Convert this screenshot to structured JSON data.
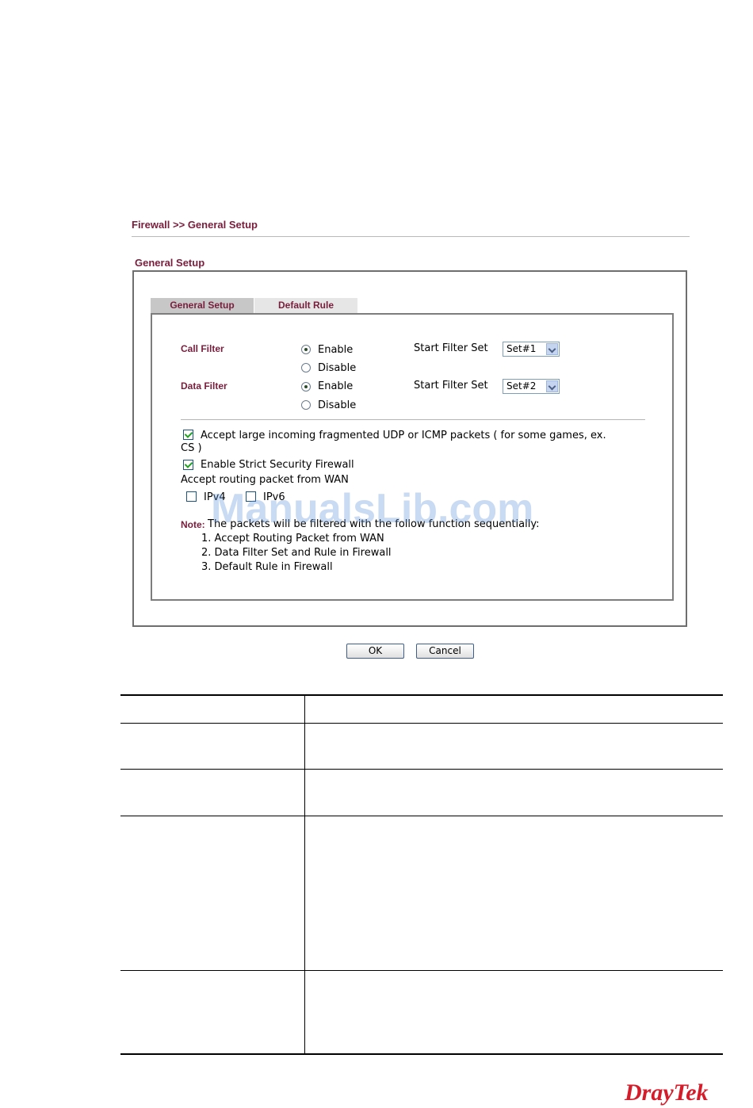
{
  "breadcrumb": "Firewall >> General Setup",
  "section_title": "General Setup",
  "tabs": [
    {
      "label": "General Setup",
      "active": true
    },
    {
      "label": "Default Rule",
      "active": false
    }
  ],
  "call_filter": {
    "label": "Call Filter",
    "enable_label": "Enable",
    "disable_label": "Disable",
    "selected": "Enable",
    "start_filter_label": "Start Filter Set",
    "start_filter_value": "Set#1"
  },
  "data_filter": {
    "label": "Data Filter",
    "enable_label": "Enable",
    "disable_label": "Disable",
    "selected": "Enable",
    "start_filter_label": "Start Filter Set",
    "start_filter_value": "Set#2"
  },
  "options": {
    "fragmented_line1": "Accept large incoming fragmented UDP or ICMP packets ( for some games, ex.",
    "fragmented_line2": "CS )",
    "fragmented_checked": true,
    "strict_label": "Enable Strict Security Firewall",
    "strict_checked": true,
    "routing_label": "Accept routing packet from WAN",
    "ipv4_label": "IPv4",
    "ipv4_checked": false,
    "ipv6_label": "IPv6",
    "ipv6_checked": false
  },
  "note": {
    "label": "Note:",
    "text": " The packets will be filtered with the follow function sequentially:",
    "items": [
      "1. Accept Routing Packet from WAN",
      "2. Data Filter Set and Rule in Firewall",
      "3. Default Rule in Firewall"
    ]
  },
  "buttons": {
    "ok": "OK",
    "cancel": "Cancel"
  },
  "watermark": "ManualsLib.com",
  "brand": "DrayTek",
  "colors": {
    "accent": "#7a1d3c",
    "brand": "#d41c2a"
  }
}
